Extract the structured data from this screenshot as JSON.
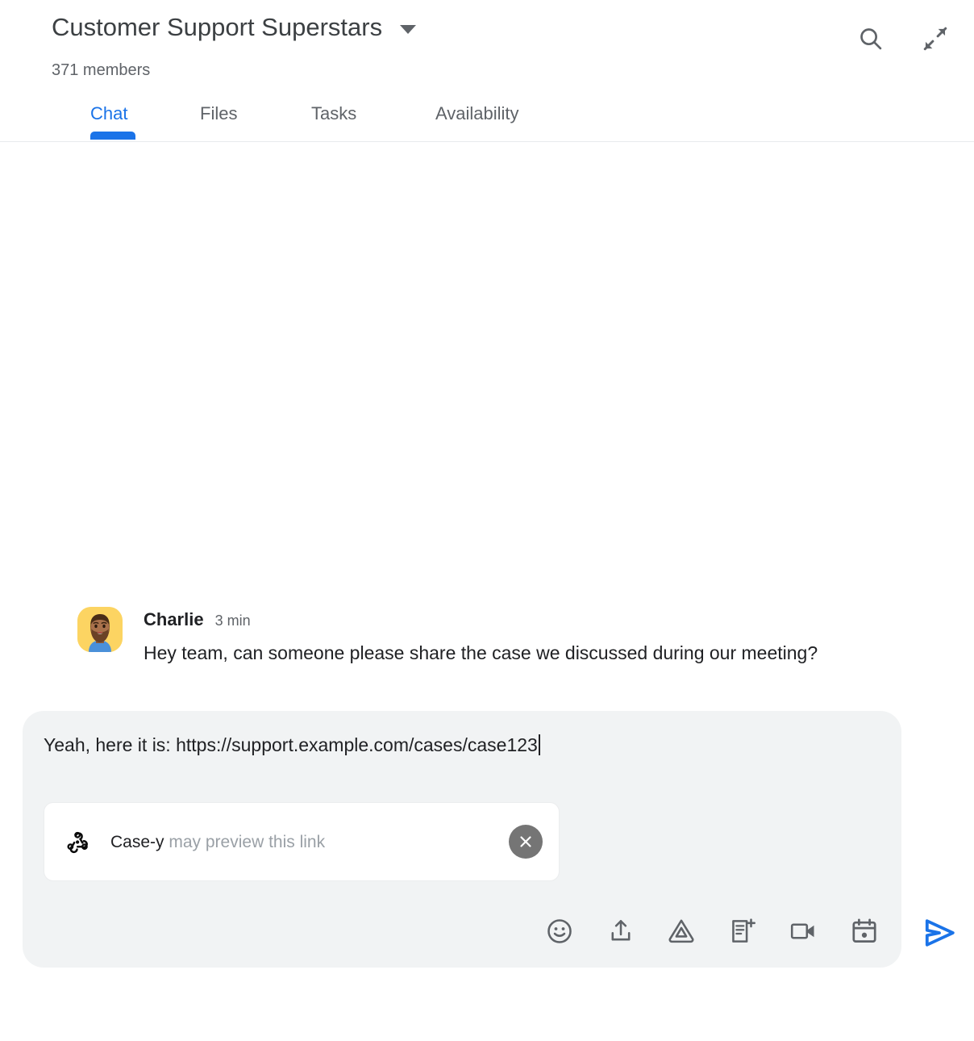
{
  "header": {
    "room_title": "Customer Support Superstars",
    "members": "371 members",
    "dropdown_icon": "chevron-down-icon",
    "actions": [
      {
        "name": "search-icon",
        "label": "Search"
      },
      {
        "name": "collapse-icon",
        "label": "Collapse"
      }
    ]
  },
  "tabs": {
    "items": [
      {
        "label": "Chat",
        "active": true
      },
      {
        "label": "Files",
        "active": false
      },
      {
        "label": "Tasks",
        "active": false
      },
      {
        "label": "Availability",
        "active": false
      }
    ],
    "active_color": "#1a73e8",
    "inactive_color": "#5f6368"
  },
  "messages": [
    {
      "sender": "Charlie",
      "timestamp": "3 min",
      "text": "Hey team, can someone please share the case we discussed during our meeting?",
      "avatar": "person-with-beard-avatar",
      "avatar_bg": "#fcd462"
    }
  ],
  "composer": {
    "text": "Yeah, here it is: https://support.example.com/cases/case123",
    "background": "#f1f3f4",
    "link_chip": {
      "app_icon": "webhook-icon",
      "app_name": "Case-y",
      "suffix": "may preview this link",
      "close_icon": "close-icon",
      "close_bg": "#757575"
    },
    "toolbar": [
      {
        "name": "emoji-icon",
        "label": "Insert emoji"
      },
      {
        "name": "upload-icon",
        "label": "Upload file"
      },
      {
        "name": "google-drive-icon",
        "label": "Add from Drive"
      },
      {
        "name": "new-document-icon",
        "label": "Create new document"
      },
      {
        "name": "video-camera-icon",
        "label": "Add video meeting"
      },
      {
        "name": "calendar-icon",
        "label": "Create event"
      }
    ],
    "send": {
      "name": "send-icon",
      "label": "Send",
      "color": "#1a73e8"
    }
  }
}
